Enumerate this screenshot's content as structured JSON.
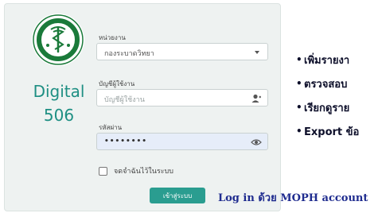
{
  "brand": {
    "title": "Digital",
    "number": "506"
  },
  "form": {
    "agency_label": "หน่วยงาน",
    "agency_value": "กองระบาดวิทยา",
    "username_label": "บัญชีผู้ใช้งาน",
    "username_placeholder": "บัญชีผู้ใช้งาน",
    "password_label": "รหัสผ่าน",
    "password_value": "••••••••",
    "remember_label": "จดจำฉันไว้ในระบบ",
    "login_button": "เข้าสู่ระบบ"
  },
  "caption": "Log in ด้วย MOPH account",
  "features": [
    {
      "bullet": "•",
      "text": "เพิ่มรายงา"
    },
    {
      "bullet": "•",
      "text": "ตรวจสอบ"
    },
    {
      "bullet": "•",
      "text": "เรียกดูราย"
    },
    {
      "bullet": "•",
      "text": "Export ข้อ"
    }
  ],
  "colors": {
    "brand": "#1e8f83",
    "button": "#2a9d90",
    "caption": "#1f2c8f",
    "logo_green": "#1a7a3a"
  },
  "icons": {
    "logo": "ministry-of-public-health-emblem",
    "agency": "chevron-down-icon",
    "username": "user-icon",
    "password": "eye-icon"
  }
}
